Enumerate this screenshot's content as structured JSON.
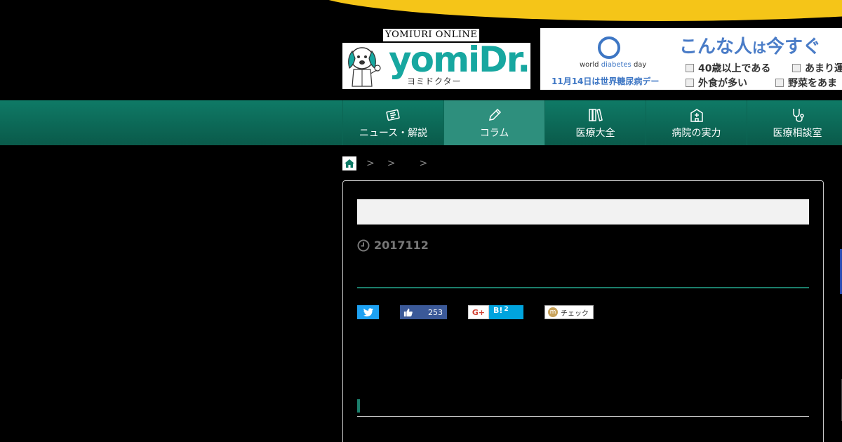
{
  "header": {
    "logo_online": "YOMIURI ONLINE",
    "logo_word": "yomiDr.",
    "logo_kana": "ヨミドクター"
  },
  "banner": {
    "wdd_prefix": "world ",
    "wdd_highlight": "diabetes",
    "wdd_suffix": " day",
    "date_text": "11月14日は世界糖尿病デー",
    "headline_a": "こんな人",
    "headline_b": "は",
    "headline_c": "今すぐ",
    "checks": [
      "40歳以上である",
      "あまり運",
      "外食が多い",
      "野菜をあま"
    ]
  },
  "nav": {
    "items": [
      {
        "label": "ニュース・解説",
        "icon": "newspaper-icon"
      },
      {
        "label": "コラム",
        "icon": "pencil-icon"
      },
      {
        "label": "医療大全",
        "icon": "books-icon"
      },
      {
        "label": "病院の実力",
        "icon": "hospital-icon"
      },
      {
        "label": "医療相談室",
        "icon": "stethoscope-icon"
      }
    ],
    "active_index": 1
  },
  "breadcrumb": {
    "separators": [
      ">",
      ">",
      ">"
    ]
  },
  "article": {
    "date": "2017112"
  },
  "share": {
    "facebook_count": "253",
    "google_label": "G+",
    "hatena_label": "B!",
    "hatena_count": "2",
    "mixi_label": "チェック"
  },
  "colors": {
    "nav_green": "#0f7a66",
    "accent_yellow": "#f5c518",
    "brand_teal": "#17a7a0",
    "banner_blue": "#3d76c4"
  }
}
